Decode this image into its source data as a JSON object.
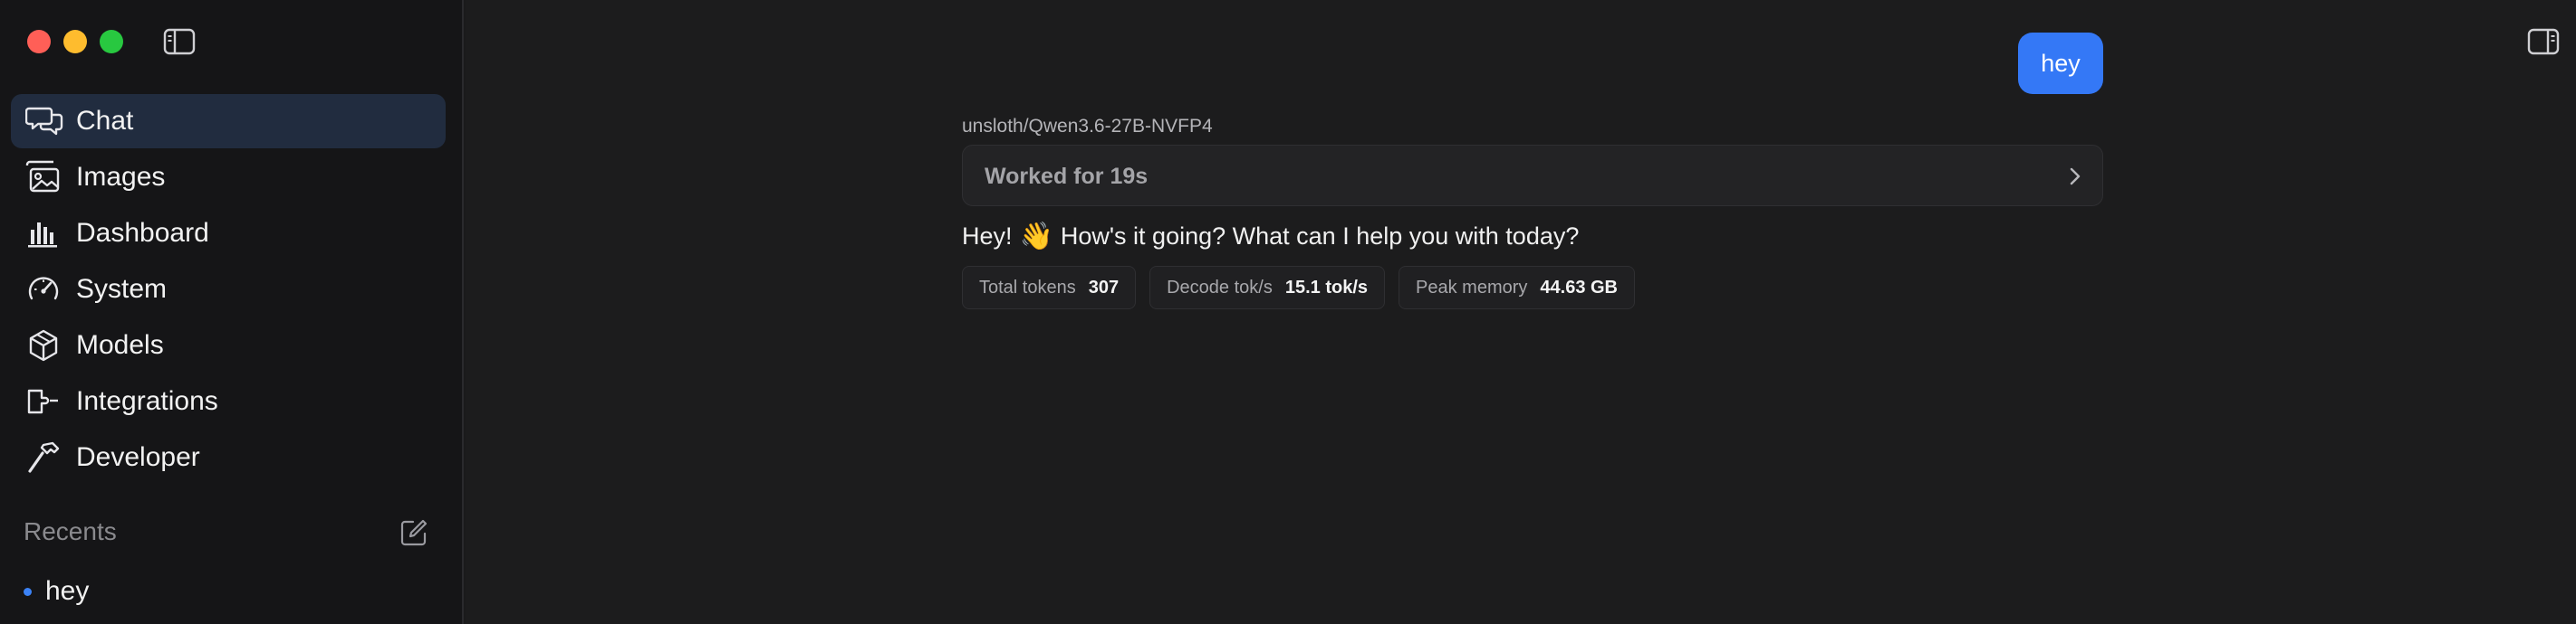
{
  "window": {
    "traffic_lights": [
      "close",
      "minimize",
      "maximize"
    ]
  },
  "sidebar": {
    "toggle_icon": "sidebar-toggle-icon",
    "items": [
      {
        "label": "Chat",
        "icon": "chat-bubbles-icon",
        "active": true
      },
      {
        "label": "Images",
        "icon": "images-icon",
        "active": false
      },
      {
        "label": "Dashboard",
        "icon": "bar-chart-icon",
        "active": false
      },
      {
        "label": "System",
        "icon": "gauge-icon",
        "active": false
      },
      {
        "label": "Models",
        "icon": "cube-icon",
        "active": false
      },
      {
        "label": "Integrations",
        "icon": "plug-icon",
        "active": false
      },
      {
        "label": "Developer",
        "icon": "hammer-icon",
        "active": false
      }
    ],
    "recents_title": "Recents",
    "recents": [
      {
        "label": "hey"
      }
    ]
  },
  "chat": {
    "user_message": "hey",
    "model_name": "unsloth/Qwen3.6-27B-NVFP4",
    "worked_label": "Worked for 19s",
    "reply_start": "Hey!",
    "reply_emoji": "👋",
    "reply_rest": "How's it going? What can I help you with today?",
    "stats": [
      {
        "key": "Total tokens",
        "value": "307"
      },
      {
        "key": "Decode tok/s",
        "value": "15.1 tok/s"
      },
      {
        "key": "Peak memory",
        "value": "44.63 GB"
      }
    ]
  },
  "colors": {
    "accent": "#3478f6",
    "active_nav_bg": "#212c3f",
    "background": "#1c1c1d"
  }
}
